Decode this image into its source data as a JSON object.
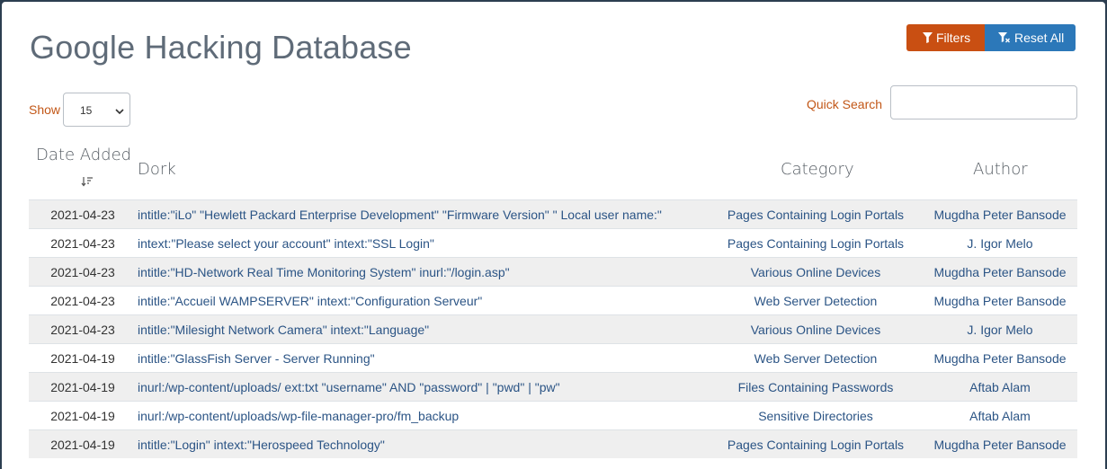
{
  "page_title": "Google Hacking Database",
  "toolbar": {
    "filters_label": "Filters",
    "reset_label": "Reset All"
  },
  "controls": {
    "show_label": "Show",
    "show_value": "15",
    "quick_search_label": "Quick Search",
    "quick_search_value": ""
  },
  "table": {
    "headers": {
      "date": "Date Added",
      "dork": "Dork",
      "category": "Category",
      "author": "Author"
    },
    "rows": [
      {
        "date": "2021-04-23",
        "dork": "intitle:\"iLo\" \"Hewlett Packard Enterprise Development\" \"Firmware Version\" \" Local user name:\"",
        "category": "Pages Containing Login Portals",
        "author": "Mugdha Peter Bansode"
      },
      {
        "date": "2021-04-23",
        "dork": "intext:\"Please select your account\" intext:\"SSL Login\"",
        "category": "Pages Containing Login Portals",
        "author": "J. Igor Melo"
      },
      {
        "date": "2021-04-23",
        "dork": "intitle:\"HD-Network Real Time Monitoring System\" inurl:\"/login.asp\"",
        "category": "Various Online Devices",
        "author": "Mugdha Peter Bansode"
      },
      {
        "date": "2021-04-23",
        "dork": "intitle:\"Accueil WAMPSERVER\" intext:\"Configuration Serveur\"",
        "category": "Web Server Detection",
        "author": "Mugdha Peter Bansode"
      },
      {
        "date": "2021-04-23",
        "dork": "intitle:\"Milesight Network Camera\" intext:\"Language\"",
        "category": "Various Online Devices",
        "author": "J. Igor Melo"
      },
      {
        "date": "2021-04-19",
        "dork": "intitle:\"GlassFish Server - Server Running\"",
        "category": "Web Server Detection",
        "author": "Mugdha Peter Bansode"
      },
      {
        "date": "2021-04-19",
        "dork": "inurl:/wp-content/uploads/ ext:txt \"username\" AND \"password\" | \"pwd\" | \"pw\"",
        "category": "Files Containing Passwords",
        "author": "Aftab Alam"
      },
      {
        "date": "2021-04-19",
        "dork": "inurl:/wp-content/uploads/wp-file-manager-pro/fm_backup",
        "category": "Sensitive Directories",
        "author": "Aftab Alam"
      },
      {
        "date": "2021-04-19",
        "dork": "intitle:\"Login\" intext:\"Herospeed Technology\"",
        "category": "Pages Containing Login Portals",
        "author": "Mugdha Peter Bansode"
      }
    ]
  },
  "colors": {
    "filters_button": "#c94f12",
    "reset_button": "#2c78b9",
    "link": "#2b5485",
    "label_accent": "#c25717",
    "stripe": "#efefef"
  },
  "icons": {
    "filter": "filter-icon",
    "reset": "filter-clear-icon",
    "sort": "sort-desc-icon",
    "select": "chevron-down-icon"
  }
}
